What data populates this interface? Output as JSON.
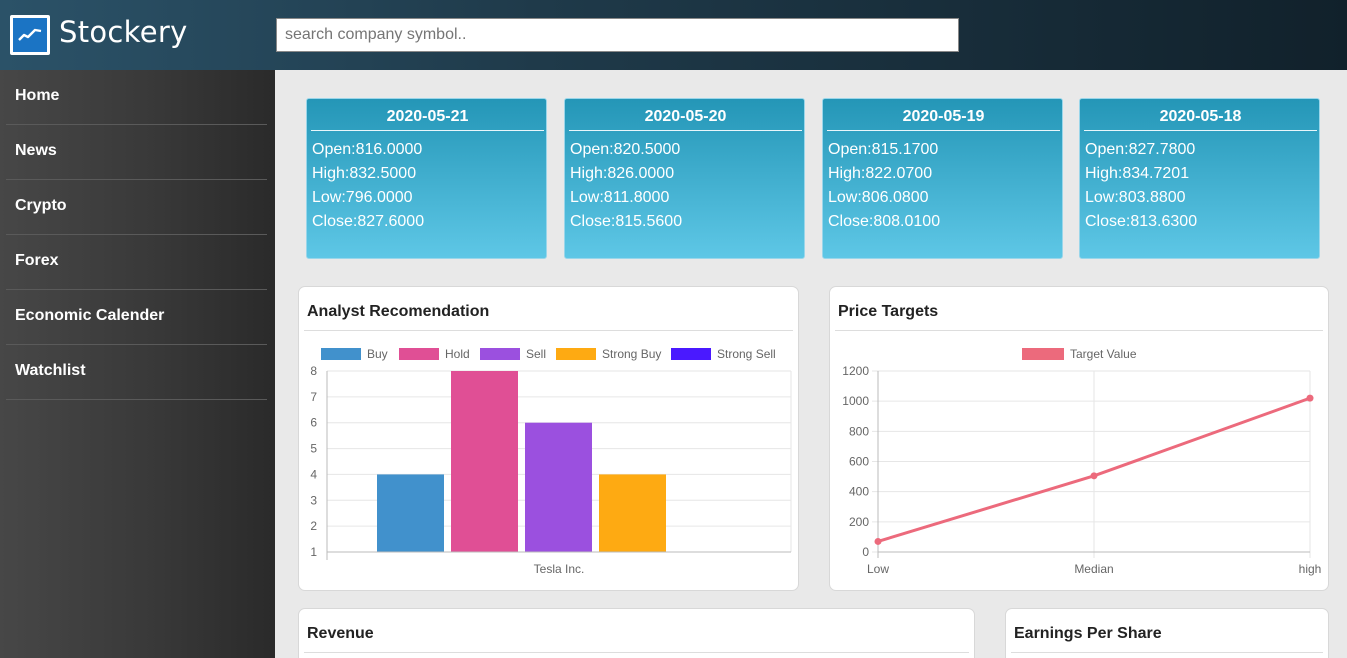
{
  "header": {
    "brand": "Stockery",
    "logo_icon": "chart-trend-icon",
    "search_placeholder": "search company symbol.."
  },
  "sidebar": {
    "items": [
      {
        "label": "Home"
      },
      {
        "label": "News"
      },
      {
        "label": "Crypto"
      },
      {
        "label": "Forex"
      },
      {
        "label": "Economic Calender"
      },
      {
        "label": "Watchlist"
      }
    ]
  },
  "daily": [
    {
      "date": "2020-05-21",
      "open": "Open:816.0000",
      "high": "High:832.5000",
      "low": "Low:796.0000",
      "close": "Close:827.6000"
    },
    {
      "date": "2020-05-20",
      "open": "Open:820.5000",
      "high": "High:826.0000",
      "low": "Low:811.8000",
      "close": "Close:815.5600"
    },
    {
      "date": "2020-05-19",
      "open": "Open:815.1700",
      "high": "High:822.0700",
      "low": "Low:806.0800",
      "close": "Close:808.0100"
    },
    {
      "date": "2020-05-18",
      "open": "Open:827.7800",
      "high": "High:834.7201",
      "low": "Low:803.8800",
      "close": "Close:813.6300"
    }
  ],
  "panels": {
    "analyst_title": "Analyst Recomendation",
    "targets_title": "Price Targets",
    "revenue_title": "Revenue",
    "eps_title": "Earnings Per Share"
  },
  "chart_data": [
    {
      "type": "bar",
      "categories": [
        "Tesla Inc."
      ],
      "series": [
        {
          "name": "Buy",
          "values": [
            4
          ],
          "color": "#4191cc"
        },
        {
          "name": "Hold",
          "values": [
            8
          ],
          "color": "#e04f95"
        },
        {
          "name": "Sell",
          "values": [
            6
          ],
          "color": "#9b50df"
        },
        {
          "name": "Strong Buy",
          "values": [
            4
          ],
          "color": "#feaa12"
        },
        {
          "name": "Strong Sell",
          "values": [
            0
          ],
          "color": "#4a19ff"
        }
      ],
      "ylim": [
        1,
        8
      ],
      "yticks": [
        "1",
        "2",
        "3",
        "4",
        "5",
        "6",
        "7",
        "8"
      ],
      "legend": "top",
      "grid": true
    },
    {
      "type": "line",
      "categories": [
        "Low",
        "Median",
        "high"
      ],
      "series": [
        {
          "name": "Target Value",
          "values": [
            70,
            505,
            1020
          ],
          "color": "#ec6a7c"
        }
      ],
      "ylim": [
        0,
        1200
      ],
      "yticks": [
        "0",
        "200",
        "400",
        "600",
        "800",
        "1000",
        "1200"
      ],
      "legend": "top",
      "grid": true
    }
  ]
}
